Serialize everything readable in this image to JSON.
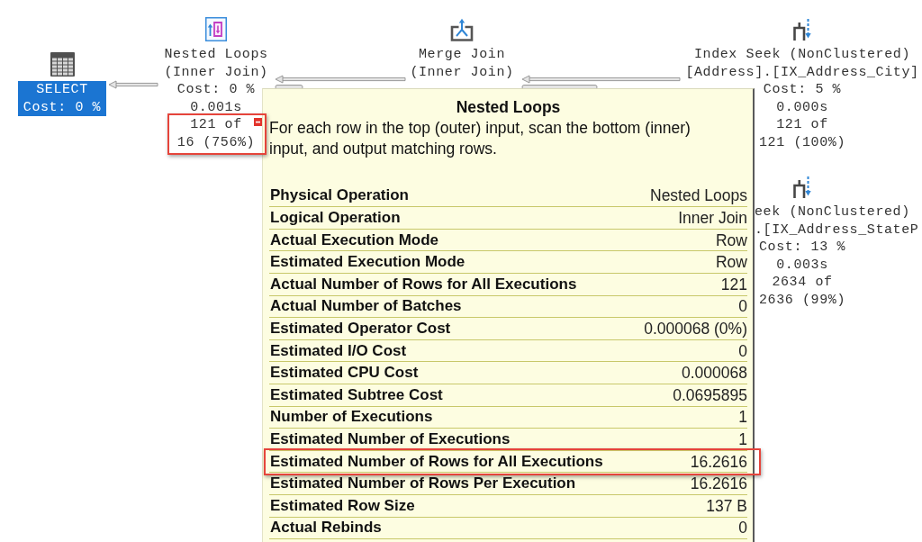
{
  "diagram": {
    "nodes": [
      {
        "kind": "select",
        "operator": "SELECT",
        "cost": "Cost: 0 %",
        "warning": false,
        "highlighted": false,
        "selected": true
      },
      {
        "kind": "nested_loops",
        "operator": "Nested Loops",
        "logical_op": "(Inner Join)",
        "cost": "Cost: 0 %",
        "time": "0.001s",
        "actual_rows": "121 of",
        "estimated_rows": "16 (756%)",
        "warning": true,
        "highlighted": true,
        "selected": false
      },
      {
        "kind": "merge_join",
        "operator": "Merge Join",
        "logical_op": "(Inner Join)",
        "warning": false,
        "highlighted": false,
        "selected": false
      },
      {
        "kind": "index_seek",
        "operator": "Index Seek (NonClustered)",
        "object": "[Address].[IX_Address_City]",
        "cost": "Cost: 5 %",
        "time": "0.000s",
        "actual_rows": "121 of",
        "estimated_rows": "121 (100%)",
        "warning": false,
        "highlighted": false,
        "selected": false
      },
      {
        "kind": "index_seek",
        "operator": "eek (NonClustered)",
        "object": ".[IX_Address_StateP",
        "cost": "Cost: 13 %",
        "time": "0.003s",
        "actual_rows": "2634 of",
        "estimated_rows": "2636 (99%)",
        "warning": false,
        "highlighted": false,
        "selected": false
      }
    ]
  },
  "tooltip": {
    "title": "Nested Loops",
    "description": "For each row in the top (outer) input, scan the bottom (inner) input, and output matching rows.",
    "rows": [
      {
        "label": "Physical Operation",
        "value": "Nested Loops",
        "highlighted": false
      },
      {
        "label": "Logical Operation",
        "value": "Inner Join",
        "highlighted": false
      },
      {
        "label": "Actual Execution Mode",
        "value": "Row",
        "highlighted": false
      },
      {
        "label": "Estimated Execution Mode",
        "value": "Row",
        "highlighted": false
      },
      {
        "label": "Actual Number of Rows for All Executions",
        "value": "121",
        "highlighted": false
      },
      {
        "label": "Actual Number of Batches",
        "value": "0",
        "highlighted": false
      },
      {
        "label": "Estimated Operator Cost",
        "value": "0.000068 (0%)",
        "highlighted": false
      },
      {
        "label": "Estimated I/O Cost",
        "value": "0",
        "highlighted": false
      },
      {
        "label": "Estimated CPU Cost",
        "value": "0.000068",
        "highlighted": false
      },
      {
        "label": "Estimated Subtree Cost",
        "value": "0.0695895",
        "highlighted": false
      },
      {
        "label": "Number of Executions",
        "value": "1",
        "highlighted": false
      },
      {
        "label": "Estimated Number of Executions",
        "value": "1",
        "highlighted": false
      },
      {
        "label": "Estimated Number of Rows for All Executions",
        "value": "16.2616",
        "highlighted": true
      },
      {
        "label": "Estimated Number of Rows Per Execution",
        "value": "16.2616",
        "highlighted": false
      },
      {
        "label": "Estimated Row Size",
        "value": "137 B",
        "highlighted": false
      },
      {
        "label": "Actual Rebinds",
        "value": "0",
        "highlighted": false
      }
    ]
  }
}
